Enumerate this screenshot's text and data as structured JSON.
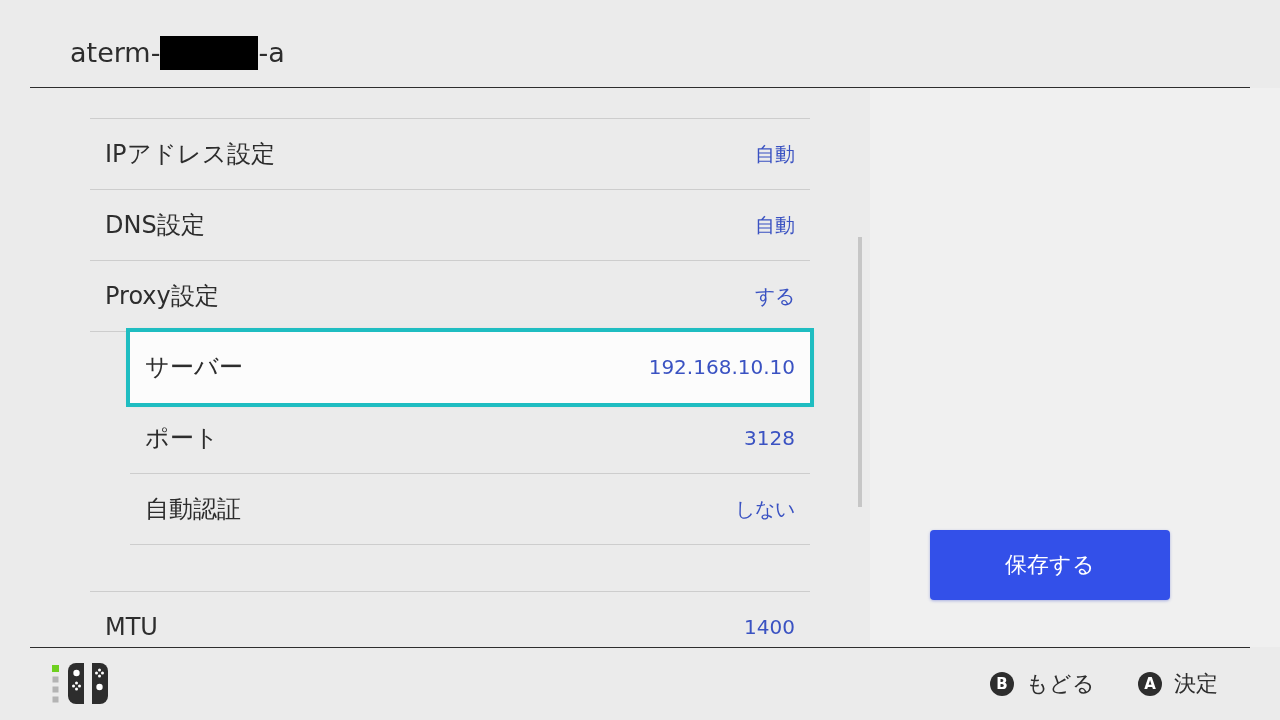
{
  "header": {
    "title_prefix": "aterm-",
    "redacted": true,
    "title_suffix": "-a"
  },
  "settings": [
    {
      "label": "IPアドレス設定",
      "value": "自動",
      "selected": false
    },
    {
      "label": "DNS設定",
      "value": "自動",
      "selected": false
    },
    {
      "label": "Proxy設定",
      "value": "する",
      "selected": false,
      "children": [
        {
          "label": "サーバー",
          "value": "192.168.10.10",
          "selected": true
        },
        {
          "label": "ポート",
          "value": "3128",
          "selected": false
        },
        {
          "label": "自動認証",
          "value": "しない",
          "selected": false
        }
      ]
    },
    {
      "label": "MTU",
      "value": "1400",
      "selected": false
    }
  ],
  "save_button": {
    "label": "保存する"
  },
  "footer": {
    "hints": [
      {
        "button": "B",
        "label": "もどる"
      },
      {
        "button": "A",
        "label": "決定"
      }
    ]
  }
}
